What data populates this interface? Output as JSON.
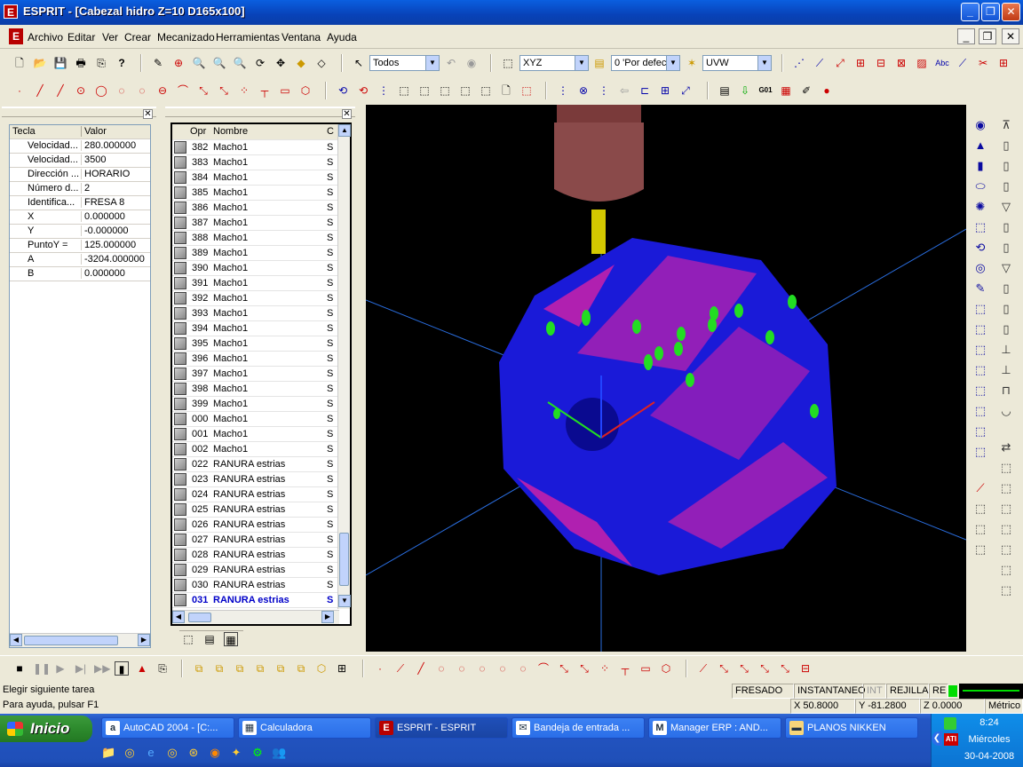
{
  "window": {
    "title": "ESPRIT - [Cabezal hidro Z=10 D165x100]",
    "icon": "E"
  },
  "menu": [
    "Archivo",
    "Editar",
    "Ver",
    "Crear",
    "Mecanizado",
    "Herramientas",
    "Ventana",
    "Ayuda"
  ],
  "toolbar": {
    "filter_combo": "Todos",
    "plane_combo": "XYZ",
    "layer_combo": "0 'Por defec",
    "uvw_combo": "UVW"
  },
  "properties": {
    "headers": [
      "Tecla",
      "Valor"
    ],
    "rows": [
      {
        "key": "Velocidad...",
        "value": "280.000000"
      },
      {
        "key": "Velocidad...",
        "value": "3500"
      },
      {
        "key": "Dirección ...",
        "value": "HORARIO"
      },
      {
        "key": "Número d...",
        "value": "2"
      },
      {
        "key": "Identifica...",
        "value": "FRESA 8"
      },
      {
        "key": "X",
        "value": "0.000000"
      },
      {
        "key": "Y",
        "value": "-0.000000"
      },
      {
        "key": "PuntoY =",
        "value": "125.000000"
      },
      {
        "key": "A",
        "value": "-3204.000000"
      },
      {
        "key": "B",
        "value": "0.000000"
      }
    ]
  },
  "operations": {
    "headers": [
      "Opr",
      "Nombre",
      "C"
    ],
    "rows": [
      {
        "n": "382",
        "name": "Macho1",
        "c": "S"
      },
      {
        "n": "383",
        "name": "Macho1",
        "c": "S"
      },
      {
        "n": "384",
        "name": "Macho1",
        "c": "S"
      },
      {
        "n": "385",
        "name": "Macho1",
        "c": "S"
      },
      {
        "n": "386",
        "name": "Macho1",
        "c": "S"
      },
      {
        "n": "387",
        "name": "Macho1",
        "c": "S"
      },
      {
        "n": "388",
        "name": "Macho1",
        "c": "S"
      },
      {
        "n": "389",
        "name": "Macho1",
        "c": "S"
      },
      {
        "n": "390",
        "name": "Macho1",
        "c": "S"
      },
      {
        "n": "391",
        "name": "Macho1",
        "c": "S"
      },
      {
        "n": "392",
        "name": "Macho1",
        "c": "S"
      },
      {
        "n": "393",
        "name": "Macho1",
        "c": "S"
      },
      {
        "n": "394",
        "name": "Macho1",
        "c": "S"
      },
      {
        "n": "395",
        "name": "Macho1",
        "c": "S"
      },
      {
        "n": "396",
        "name": "Macho1",
        "c": "S"
      },
      {
        "n": "397",
        "name": "Macho1",
        "c": "S"
      },
      {
        "n": "398",
        "name": "Macho1",
        "c": "S"
      },
      {
        "n": "399",
        "name": "Macho1",
        "c": "S"
      },
      {
        "n": "000",
        "name": "Macho1",
        "c": "S"
      },
      {
        "n": "001",
        "name": "Macho1",
        "c": "S"
      },
      {
        "n": "002",
        "name": "Macho1",
        "c": "S"
      },
      {
        "n": "022",
        "name": "RANURA estrias",
        "c": "S"
      },
      {
        "n": "023",
        "name": "RANURA estrias",
        "c": "S"
      },
      {
        "n": "024",
        "name": "RANURA estrias",
        "c": "S"
      },
      {
        "n": "025",
        "name": "RANURA estrias",
        "c": "S"
      },
      {
        "n": "026",
        "name": "RANURA estrias",
        "c": "S"
      },
      {
        "n": "027",
        "name": "RANURA estrias",
        "c": "S"
      },
      {
        "n": "028",
        "name": "RANURA estrias",
        "c": "S"
      },
      {
        "n": "029",
        "name": "RANURA estrias",
        "c": "S"
      },
      {
        "n": "030",
        "name": "RANURA estrias",
        "c": "S"
      },
      {
        "n": "031",
        "name": "RANURA estrias",
        "c": "S",
        "selected": true
      }
    ]
  },
  "status": {
    "prompt": "Elegir siguiente tarea",
    "help": "Para ayuda, pulsar F1",
    "mode": "FRESADO",
    "snap": "INSTANTANEO",
    "int": "INT",
    "grid": "REJILLA",
    "re": "RE",
    "x": "X 50.8000",
    "y": "Y -81.2800",
    "z": "Z 0.0000",
    "units": "Métrico"
  },
  "taskbar": {
    "start": "Inicio",
    "tasks": [
      {
        "label": "AutoCAD 2004 - [C:...",
        "icon": "a"
      },
      {
        "label": "Calculadora",
        "icon": "▦"
      },
      {
        "label": "ESPRIT - ESPRIT",
        "icon": "E",
        "active": true
      },
      {
        "label": "Bandeja de entrada ...",
        "icon": "✉"
      },
      {
        "label": "Manager ERP : AND...",
        "icon": "M"
      },
      {
        "label": "PLANOS NIKKEN",
        "icon": "▬"
      }
    ],
    "clock": {
      "time": "8:24",
      "day": "Miércoles",
      "date": "30-04-2008"
    }
  },
  "colors": {
    "part_body": "#1a1ad8",
    "part_magenta": "#b020b0",
    "holes": "#22dd22",
    "spindle": "#8a4a4a",
    "tool": "#d4c800",
    "axis_lines": "#2a6ee0"
  }
}
